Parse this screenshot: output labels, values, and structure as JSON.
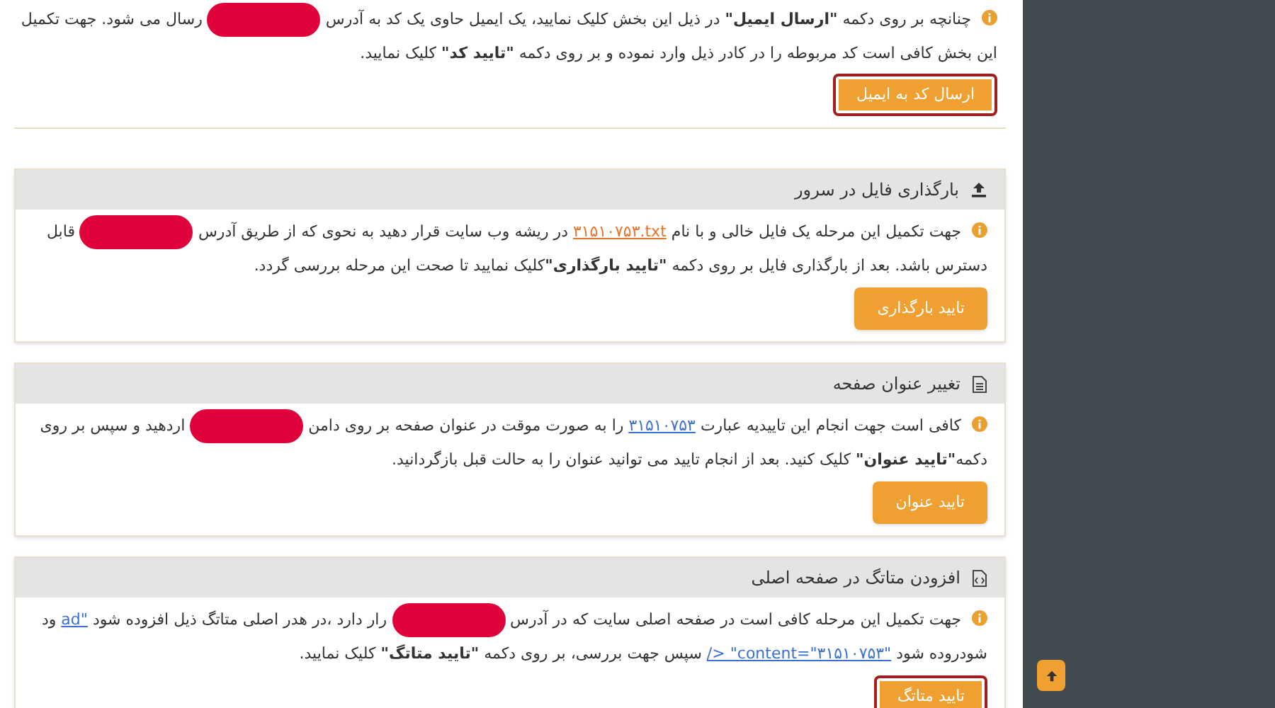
{
  "intro": {
    "segments": [
      {
        "kind": "text",
        "text": "چنانچه بر روی دکمه **\"ارسال ایمیل\"** در ذیل این بخش کلیک نمایید، یک ایمیل حاوی یک کد به آدرس"
      },
      {
        "kind": "redacted"
      },
      {
        "kind": "text",
        "text": "رسال می شود. جهت تکمیل این بخش کافی است کد مربوطه را در کادر ذیل وارد نموده و بر روی دکمه **\"تایید کد\"** کلیک نمایید."
      }
    ],
    "button": {
      "label": "ارسال کد به ایمیل",
      "focused": true
    }
  },
  "cards": [
    {
      "title": "بارگذاری فایل در سرور",
      "segments": [
        {
          "kind": "text",
          "text": "جهت تکمیل این مرحله یک فایل خالی و با نام"
        },
        {
          "kind": "link",
          "text": "۳۱۵۱۰۷۵۳.txt",
          "color": "#e8732a"
        },
        {
          "kind": "text",
          "text": "در ریشه وب سایت قرار دهید به نحوی که از طریق آدرس"
        },
        {
          "kind": "redacted"
        },
        {
          "kind": "text",
          "text": "قابل دسترس باشد. بعد از بارگذاری فایل بر روی دکمه **\"تایید بارگذاری\"**کلیک نمایید تا صحت این مرحله بررسی گردد."
        }
      ],
      "button": {
        "label": "تایید بارگذاری",
        "focused": false
      }
    },
    {
      "title": "تغییر عنوان صفحه",
      "segments": [
        {
          "kind": "text",
          "text": "کافی است جهت انجام این تاییدیه عبارت"
        },
        {
          "kind": "link",
          "text": "۳۱۵۱۰۷۵۳",
          "color": "#3b6fd1"
        },
        {
          "kind": "text",
          "text": "را به صورت موقت در عنوان صفحه بر روی دامن"
        },
        {
          "kind": "redacted"
        },
        {
          "kind": "text",
          "text": "اردهید و سپس بر روی دکمه**\"تایید عنوان\"** کلیک کنید. بعد از انجام تایید می توانید عنوان را به حالت قبل بازگردانید."
        }
      ],
      "button": {
        "label": "تایید عنوان",
        "focused": false
      }
    },
    {
      "title": "افزودن متاتگ در صفحه اصلی",
      "segments": [
        {
          "kind": "text",
          "text": "جهت تکمیل این مرحله کافی است در صفحه اصلی سایت که در آدرس"
        },
        {
          "kind": "redacted"
        },
        {
          "kind": "text",
          "text": "رار دارد ،در هدر اصلی متاتگ ذیل افزوده شود"
        },
        {
          "kind": "link",
          "text": "ad\"",
          "color": "#3b6fd1"
        },
        {
          "kind": "text",
          "text": "ود شودروده شود"
        },
        {
          "kind": "link",
          "text": "/> \"content=\"۳۱۵۱۰۷۵۳\"",
          "color": "#3b6fd1"
        },
        {
          "kind": "text",
          "text": "سپس جهت بررسی، بر روی دکمه **\"تایید متاتگ\"** کلیک نمایید."
        }
      ],
      "button": {
        "label": "تایید متاتگ",
        "focused": true
      }
    }
  ]
}
